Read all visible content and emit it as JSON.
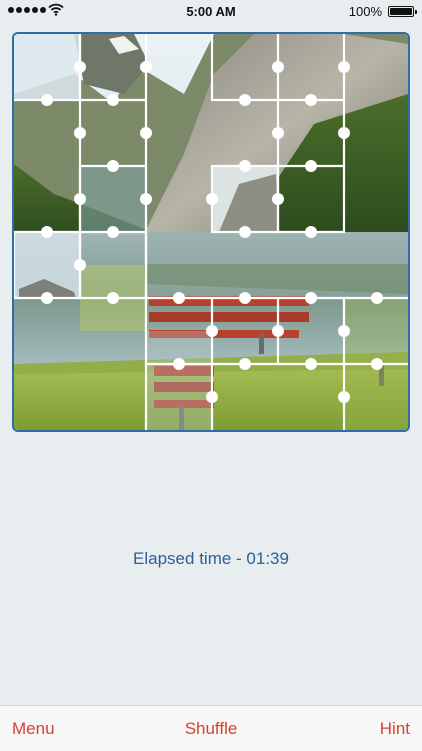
{
  "status": {
    "time": "5:00 AM",
    "battery": "100%",
    "battery_level": 1.0,
    "signal_bars": 5
  },
  "puzzle": {
    "grid_columns": 6,
    "grid_rows": 6,
    "frame_color": "#2f6ea4",
    "image_description": "lake-with-cliffs-and-red-bench"
  },
  "timer": {
    "label": "Elapsed time",
    "separator": " - ",
    "value": "01:39"
  },
  "toolbar": {
    "menu_label": "Menu",
    "shuffle_label": "Shuffle",
    "hint_label": "Hint",
    "accent_color": "#d9402f"
  }
}
